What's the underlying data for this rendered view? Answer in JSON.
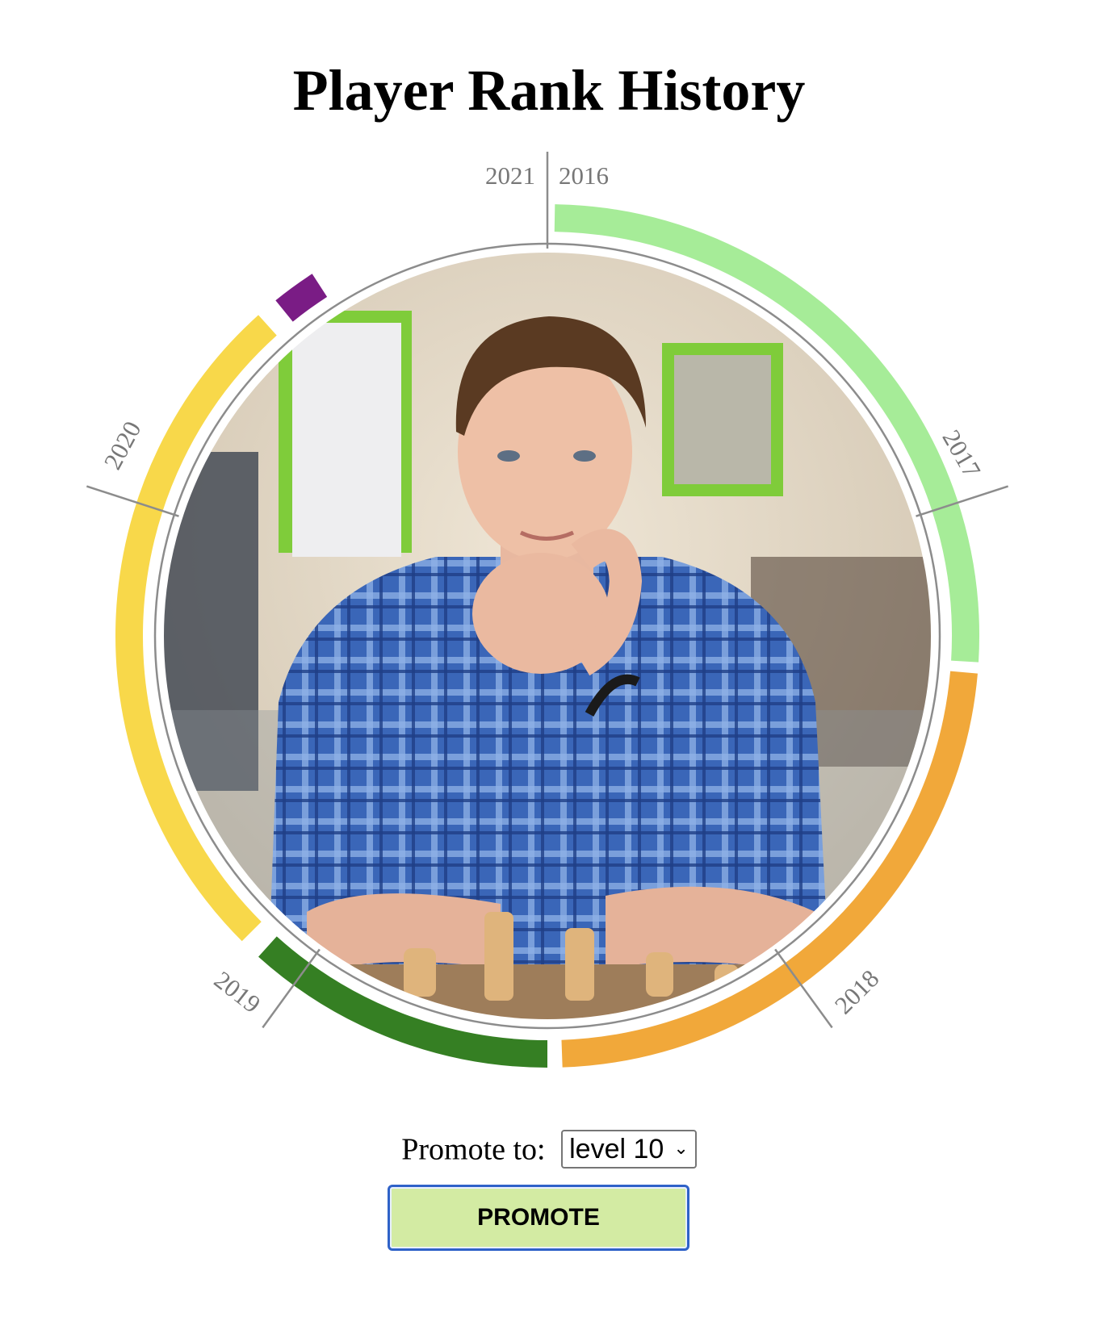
{
  "page": {
    "title": "Player Rank History"
  },
  "wheel": {
    "year_labels": [
      "2021",
      "2016",
      "2017",
      "2018",
      "2019",
      "2020"
    ],
    "rank_segments": [
      {
        "color": "#a6ec98"
      },
      {
        "color": "#f1a83a"
      },
      {
        "color": "#357f23"
      },
      {
        "color": "#f8d84a"
      },
      {
        "color": "#7a1c85"
      }
    ],
    "photo": {
      "icon": "player-portrait-photo"
    }
  },
  "promote": {
    "label": "Promote to:",
    "selected_level": "level 10",
    "button_label": "PROMOTE"
  }
}
